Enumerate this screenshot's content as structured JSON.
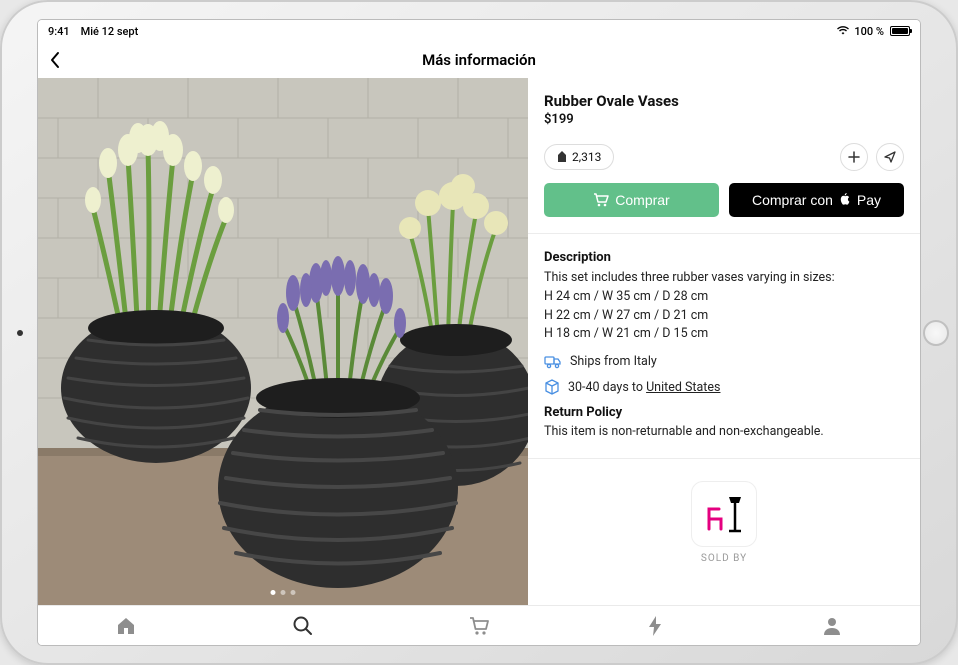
{
  "status": {
    "time": "9:41",
    "date": "Mié 12 sept",
    "battery_pct": "100 %",
    "wifi": true
  },
  "nav": {
    "title": "Más información"
  },
  "product": {
    "title": "Rubber Ovale Vases",
    "price": "$199",
    "like_count": "2,313"
  },
  "actions": {
    "buy_label": "Comprar",
    "apple_pay_prefix": "Comprar con ",
    "apple_pay_suffix": "Pay"
  },
  "description": {
    "heading": "Description",
    "intro": "This set includes three rubber vases varying in sizes:",
    "dims": [
      "H 24 cm / W 35 cm / D 28 cm",
      "H 22 cm / W 27 cm / D 21 cm",
      "H 18 cm / W 21 cm / D 15 cm"
    ]
  },
  "shipping": {
    "ships_from": "Ships from Italy",
    "eta_prefix": "30-40 days to ",
    "eta_destination": "United States"
  },
  "returns": {
    "heading": "Return Policy",
    "body": "This item is non-returnable and non-exchangeable."
  },
  "seller": {
    "sold_by_label": "SOLD BY"
  },
  "colors": {
    "accent_green": "#62c08a",
    "info_blue": "#4a90e2"
  }
}
